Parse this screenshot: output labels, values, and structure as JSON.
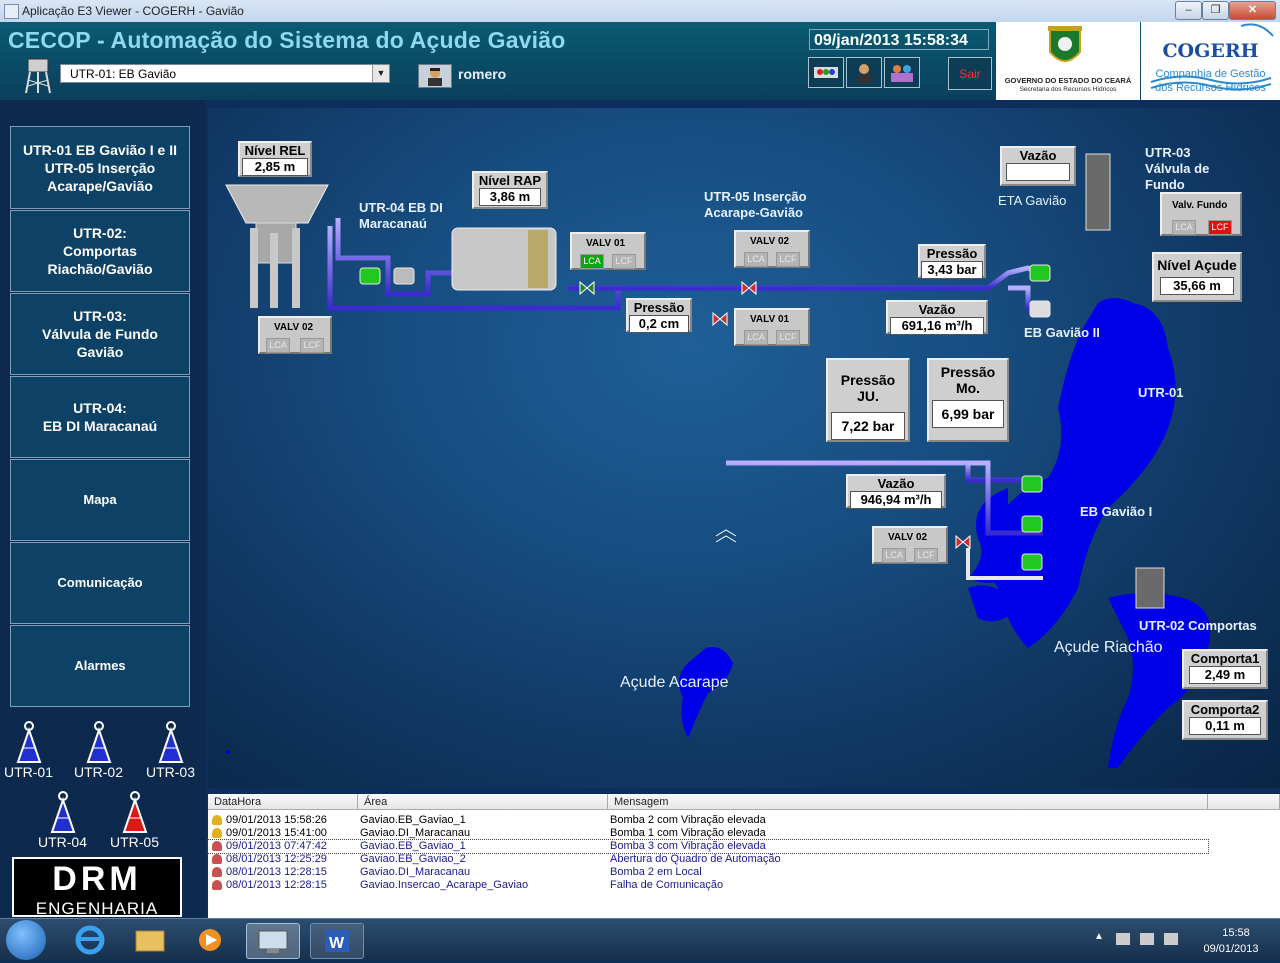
{
  "window": {
    "title": "Aplicação E3 Viewer - COGERH - Gavião",
    "buttons": [
      "–",
      "❐",
      "✕"
    ]
  },
  "header": {
    "title": "CECOP - Automação do Sistema do Açude Gavião",
    "datetime": "09/jan/2013 15:58:34",
    "utr_selected": "UTR-01: EB Gavião",
    "user": "romero",
    "exit_label": "Sair",
    "gov_logo_text": "GOVERNO DO ESTADO DO CEARÁ",
    "gov_logo_sub": "Secretaria dos Recursos Hídricos",
    "cogerh_name": "COGERH",
    "cogerh_sub1": "Companhia de Gestão",
    "cogerh_sub2": "dos Recursos Hídricos"
  },
  "nav": [
    {
      "label": "UTR-01 EB Gavião I e II\nUTR-05 Inserção\nAcarape/Gavião"
    },
    {
      "label": "UTR-02:\nComportas\nRiachão/Gavião"
    },
    {
      "label": "UTR-03:\nVálvula de Fundo\nGavião"
    },
    {
      "label": "UTR-04:\nEB DI Maracanaú"
    },
    {
      "label": "Mapa"
    },
    {
      "label": "Comunicação"
    },
    {
      "label": "Alarmes"
    }
  ],
  "antennas": [
    "UTR-01",
    "UTR-02",
    "UTR-03",
    "UTR-04",
    "UTR-05"
  ],
  "company_logo": {
    "top": "DRM",
    "bottom": "ENGENHARIA"
  },
  "synoptic": {
    "nivel_rel": {
      "title": "Nível REL",
      "value": "2,85 m"
    },
    "nivel_rap": {
      "title": "Nível RAP",
      "value": "3,86 m"
    },
    "utr04_label": "UTR-04 EB DI\nMaracanaú",
    "utr05_label": "UTR-05 Inserção\nAcarape-Gavião",
    "utr03_label": "UTR-03\nVálvula de\nFundo",
    "valv01_a": {
      "title": "VALV 01",
      "lca": "LCA",
      "lcf": "LCF"
    },
    "valv02_a": {
      "title": "VALV 02",
      "lca": "LCA",
      "lcf": "LCF"
    },
    "valv02_b": {
      "title": "VALV 02",
      "lca": "LCA",
      "lcf": "LCF"
    },
    "valv01_b": {
      "title": "VALV 01",
      "lca": "LCA",
      "lcf": "LCF"
    },
    "valv02_c": {
      "title": "VALV 02",
      "lca": "LCA",
      "lcf": "LCF"
    },
    "valv_fundo": {
      "title": "Valv. Fundo",
      "lca": "LCA",
      "lcf": "LCF"
    },
    "pressao_utr05": {
      "title": "Pressão",
      "value": "0,2 cm"
    },
    "pressao_gaviao2": {
      "title": "Pressão",
      "value": "3,43 bar"
    },
    "vazao_gaviao2": {
      "title": "Vazão",
      "value": "691,16 m³/h"
    },
    "vazao_eta": {
      "title": "Vazão",
      "value": ""
    },
    "eta_label": "ETA Gavião",
    "nivel_acude": {
      "title": "Nível Açude",
      "value": "35,66 m"
    },
    "pressao_ju": {
      "title": "Pressão JU.",
      "value": "7,22 bar"
    },
    "pressao_mo": {
      "title": "Pressão\nMo.",
      "value": "6,99 bar"
    },
    "vazao_gaviao1": {
      "title": "Vazão",
      "value": "946,94 m³/h"
    },
    "eb_gaviao2_label": "EB Gavião II",
    "eb_gaviao1_label": "EB Gavião I",
    "utr01_label": "UTR-01",
    "utr02_label": "UTR-02 Comportas",
    "acude_acarape": "Açude Acarape",
    "acude_riachao": "Açude Riachão",
    "comporta1": {
      "title": "Comporta1",
      "value": "2,49 m"
    },
    "comporta2": {
      "title": "Comporta2",
      "value": "0,11 m"
    }
  },
  "alarms": {
    "columns": [
      "DataHora",
      "Área",
      "Mensagem"
    ],
    "rows": [
      {
        "datetime": "09/01/2013 15:58:26",
        "area": "Gaviao.EB_Gaviao_1",
        "message": "Bomba 2 com Vibração elevada",
        "color": "#000000",
        "icon": "bell-icon"
      },
      {
        "datetime": "09/01/2013 15:41:00",
        "area": "Gaviao.DI_Maracanau",
        "message": "Bomba 1 com Vibração elevada",
        "color": "#000000",
        "icon": "bell-icon"
      },
      {
        "datetime": "09/01/2013 07:47:42",
        "area": "Gaviao.EB_Gaviao_1",
        "message": "Bomba 3 com Vibração elevada",
        "color": "#1a1a8c",
        "icon": "bell-crossed-icon"
      },
      {
        "datetime": "08/01/2013 12:25:29",
        "area": "Gaviao.EB_Gaviao_2",
        "message": "Abertura do Quadro de Automação",
        "color": "#1a1a8c",
        "icon": "bell-crossed-icon"
      },
      {
        "datetime": "08/01/2013 12:28:15",
        "area": "Gaviao.DI_Maracanau",
        "message": "Bomba 2 em Local",
        "color": "#1a1a8c",
        "icon": "bell-crossed-icon"
      },
      {
        "datetime": "08/01/2013 12:28:15",
        "area": "Gaviao.Insercao_Acarape_Gaviao",
        "message": "Falha de Comunicação",
        "color": "#1a1a8c",
        "icon": "bell-crossed-icon"
      }
    ]
  },
  "taskbar": {
    "time": "15:58",
    "date": "09/01/2013",
    "apps": [
      "start-orb-icon",
      "ie-icon",
      "explorer-icon",
      "media-player-icon",
      "e3-viewer-icon",
      "word-icon"
    ]
  }
}
